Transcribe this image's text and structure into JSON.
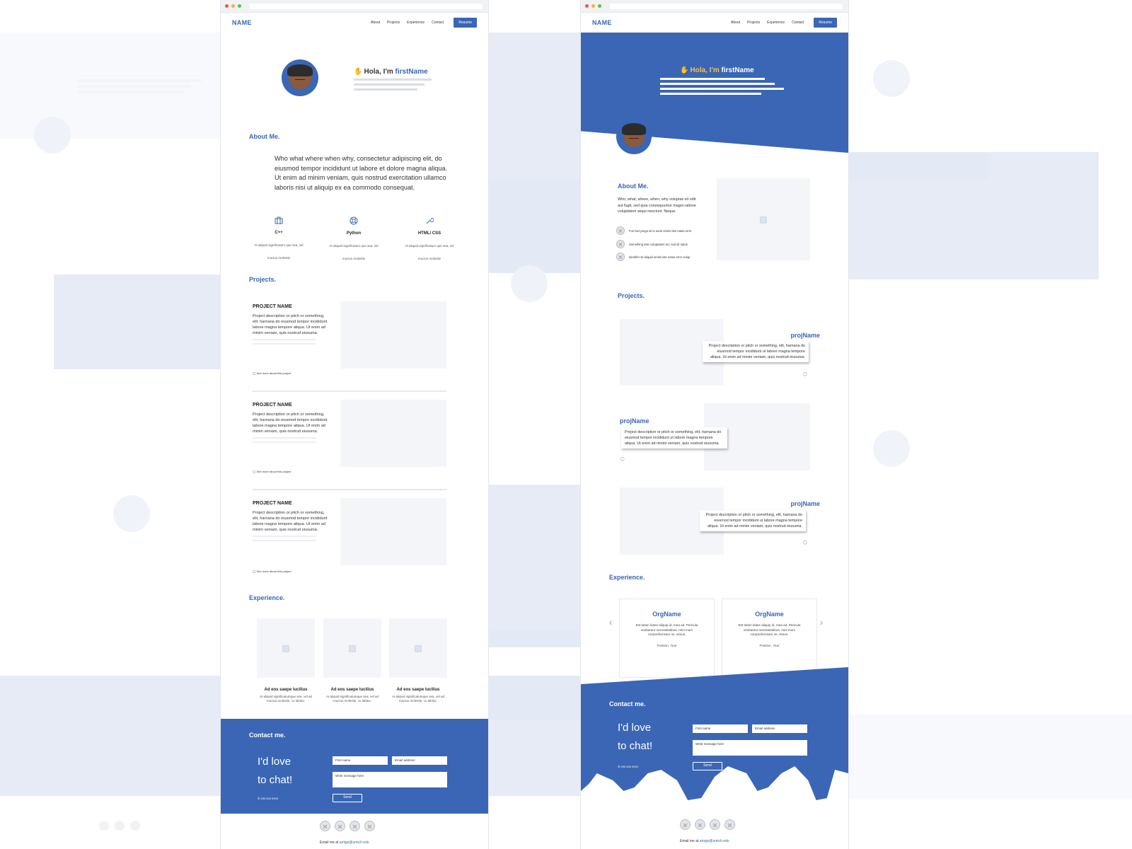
{
  "nav": {
    "brand": "NAME",
    "links": [
      "About",
      "Projects",
      "Experience",
      "Contact"
    ],
    "resume": "Resume"
  },
  "hero": {
    "greeting": "Hola, I'm",
    "first_name": "firstName"
  },
  "about": {
    "title": "About Me.",
    "text": "Who what where when why, consectetur adipiscing elit, do eiusmod tempor incididunt ut labore et dolore magna aliqua. Ut enim ad minim veniam, quis nostrud exercitation ullamco laboris nisi ut aliquip ex ea commodo consequat.",
    "text_b": "Who, what, where, when, why voluptas sit odit aut fugit, sed quia consequuntur magni ratione voluptatem sequi nesciunt. Neque.",
    "checks": [
      "Fun fact prego sit is unde omnis iste natus error",
      "Something else voluptatem acc sed sit natus",
      "Identifer sit aliquid omnis iste natus error volup"
    ]
  },
  "skills": [
    {
      "name": "C++",
      "desc": "At aliquid significatum que sea, vel mucius molestie",
      "icon": "briefcase-icon"
    },
    {
      "name": "Python",
      "desc": "At aliquid significatum que sea, vel mucius molestie",
      "icon": "lifebuoy-icon"
    },
    {
      "name": "HTML/ CSS",
      "desc": "At aliquid significatum que sea, vel mucius molestie",
      "icon": "wrench-icon"
    }
  ],
  "projects": {
    "title": "Projects.",
    "items": [
      {
        "name": "PROJECT NAME",
        "desc": "Project description or pitch or something, elit, harnana do eiusmod tempor incididunt labore magna tempore aliqua. Ut enim ad minim veniam, quis nostrud eiusuma.",
        "link": "See more about this project"
      },
      {
        "name": "PROJECT NAME",
        "desc": "Project description or pitch or something, elit, harnana do eiusmod tempor incididunt labore magna tempore aliqua. Ut enim ad minim veniam, quis nostrud eiusuma.",
        "link": "See more about this project"
      },
      {
        "name": "PROJECT NAME",
        "desc": "Project description or pitch or something, elit, harnana do eiusmod tempor incididunt labore magna tempore aliqua. Ut enim ad minim veniam, quis nostrud eiusuma.",
        "link": "See more about this project"
      }
    ],
    "b_items": [
      {
        "name": "projName",
        "desc": "Project description or pitch or something, elit, harnana do eiusmod tempor incididunt ut labore magna tempore aliqua. Ut enim ad minim veniam, quis nostrud eiusuma."
      },
      {
        "name": "projName",
        "desc": "Project description or pitch or something, elit, harnana do eiusmod tempor incididunt ut labore magna tempore aliqua. Ut enim ad minim veniam, quis nostrud eiusuma."
      },
      {
        "name": "projName",
        "desc": "Project description or pitch or something, elit, harnana do eiusmod tempor incididunt ut labore magna tempore aliqua. Ut enim ad minim veniam, quis nostrud eiusuma."
      }
    ]
  },
  "experience": {
    "title": "Experience.",
    "items": [
      {
        "title": "Ad eos saepe lucilius",
        "desc": "At aliquid significatumque sea, vel ad mucius molestie, cu labitur."
      },
      {
        "title": "Ad eos saepe lucilius",
        "desc": "At aliquid significatumque sea, vel ad mucius molestie, cu labitur."
      },
      {
        "title": "Ad eos saepe lucilius",
        "desc": "At aliquid significatumque sea, vel ad mucius molestie, cu labitur."
      }
    ],
    "orgs": [
      {
        "name": "OrgName",
        "desc": "Est tation latine aliquip id, mea ad. Pericula omittantur necessitatibus, mini mum comprehensam ne, simus.",
        "position": "Position, Year"
      },
      {
        "name": "OrgName",
        "desc": "Est tation latine aliquip id, mea ad. Pericula omittantur necessitatibus, mini mum comprehensam ne, simus.",
        "position": "Position, Year"
      }
    ]
  },
  "contact": {
    "title": "Contact me.",
    "line1": "I'd love",
    "line2": "to chat!",
    "first_name_ph": "First name",
    "email_ph": "Email address",
    "message_ph": "Write message here",
    "send": "Send",
    "phone": "000 000 0000"
  },
  "footer": {
    "email_label": "Email me at",
    "email": "amigo@umich.edu"
  },
  "colors": {
    "accent": "#3a66b5"
  }
}
